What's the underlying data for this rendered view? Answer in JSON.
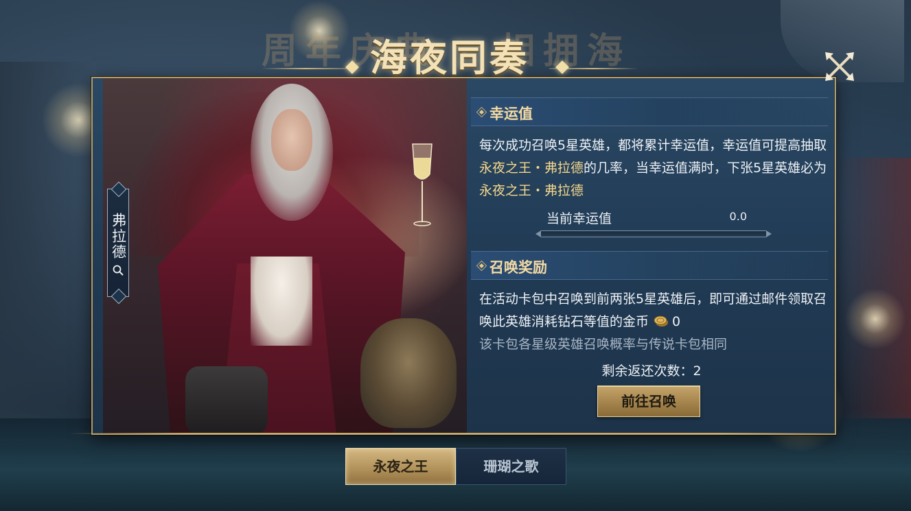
{
  "title": {
    "main": "海夜同奏",
    "background_text": "周年庆典 · 相拥海"
  },
  "hero": {
    "name": "弗拉德",
    "inspect_icon": "search-icon"
  },
  "luck_section": {
    "heading": "幸运值",
    "desc_part1": "每次成功召唤5星英雄，都将累计幸运值，幸运值可提高抽取",
    "hero_highlight_1": "永夜之王・弗拉德",
    "desc_part2": "的几率，当幸运值满时，下张5星英雄必为",
    "hero_highlight_2": "永夜之王・弗拉德",
    "current_label": "当前幸运值",
    "current_value": "0.0",
    "progress_fraction": 0
  },
  "reward_section": {
    "heading": "召唤奖励",
    "desc": "在活动卡包中召唤到前两张5星英雄后，即可通过邮件领取召唤此英雄消耗钻石等值的金币",
    "coin_icon": "gold-coin-icon",
    "coin_amount": "0",
    "note": "该卡包各星级英雄召唤概率与传说卡包相同",
    "remaining_label": "剩余返还次数",
    "remaining_value": "2",
    "remaining_text": "剩余返还次数：2",
    "summon_button": "前往召唤"
  },
  "tabs": [
    {
      "label": "永夜之王",
      "active": true
    },
    {
      "label": "珊瑚之歌",
      "active": false
    }
  ],
  "close_icon": "close-icon",
  "colors": {
    "accent_gold": "#f7d88c",
    "panel_blue": "#213b55",
    "heading_gold": "#f5dba4"
  }
}
